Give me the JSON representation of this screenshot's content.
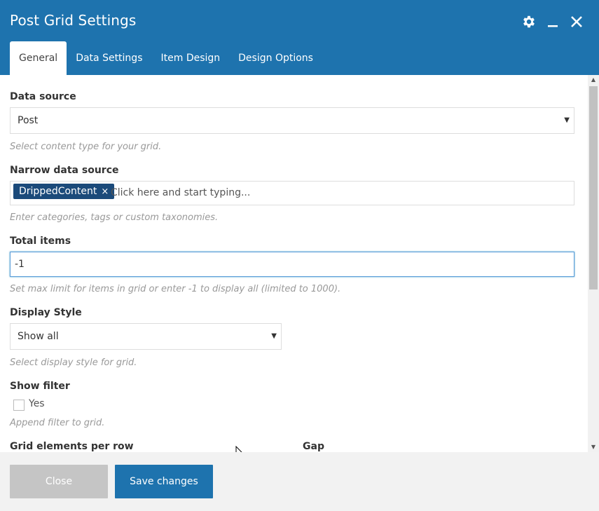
{
  "window": {
    "title": "Post Grid Settings"
  },
  "header_icons": [
    "gear-icon",
    "minimize-icon",
    "close-icon"
  ],
  "tabs": [
    {
      "label": "General",
      "active": true
    },
    {
      "label": "Data Settings",
      "active": false
    },
    {
      "label": "Item Design",
      "active": false
    },
    {
      "label": "Design Options",
      "active": false
    }
  ],
  "fields": {
    "data_source": {
      "label": "Data source",
      "value": "Post",
      "help": "Select content type for your grid."
    },
    "narrow_source": {
      "label": "Narrow data source",
      "tag": "DrippedContent",
      "tag_remove": "×",
      "placeholder": "Click here and start typing...",
      "help": "Enter categories, tags or custom taxonomies."
    },
    "total_items": {
      "label": "Total items",
      "value": "-1",
      "help": "Set max limit for items in grid or enter -1 to display all (limited to 1000)."
    },
    "display_style": {
      "label": "Display Style",
      "value": "Show all",
      "help": "Select display style for grid."
    },
    "show_filter": {
      "label": "Show filter",
      "checkbox_label": "Yes",
      "checked": false,
      "help": "Append filter to grid."
    },
    "grid_elements": {
      "label": "Grid elements per row"
    },
    "gap": {
      "label": "Gap"
    }
  },
  "footer": {
    "close_label": "Close",
    "save_label": "Save changes"
  },
  "colors": {
    "header": "#1e73ae",
    "tag": "#1b4a7a",
    "save_button": "#1e73ae",
    "close_button": "#c5c5c5"
  }
}
